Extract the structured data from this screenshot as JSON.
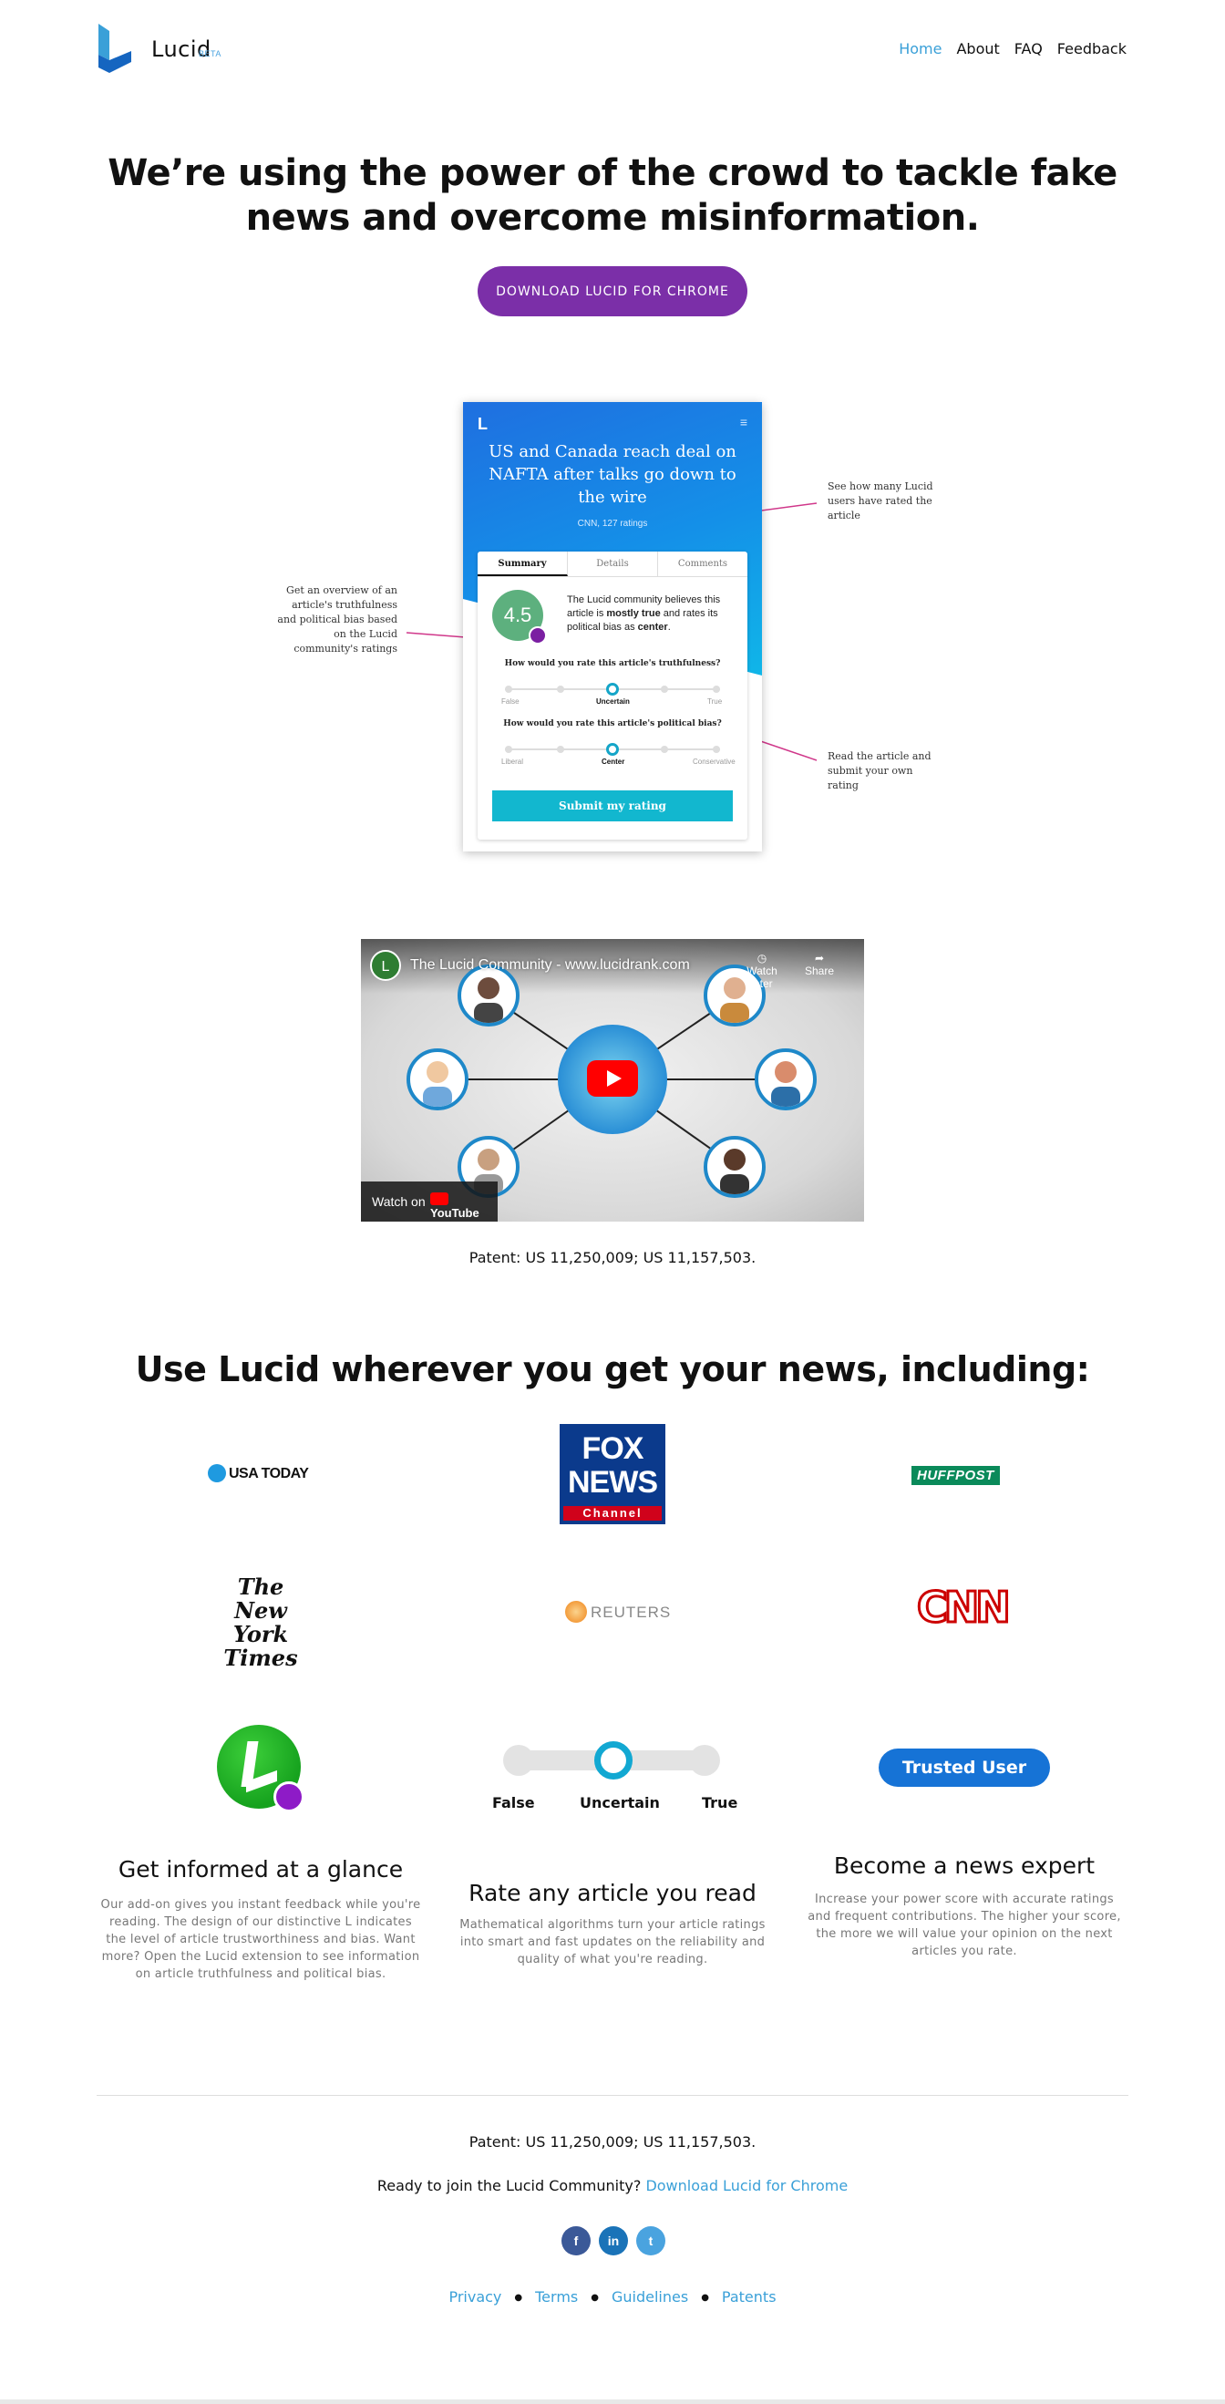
{
  "nav": {
    "logo_text": "Lucid",
    "logo_badge": "BETA",
    "links": [
      "Home",
      "About",
      "FAQ",
      "Feedback"
    ],
    "active": "Home"
  },
  "hero": {
    "title_line1": "We’re using the power of the crowd to tackle fake",
    "title_line2": "news and overcome misinformation.",
    "cta_label": "DOWNLOAD LUCID FOR CHROME"
  },
  "mockup": {
    "logo": "L",
    "menu_icon": "≡",
    "headline": "US and Canada reach deal on NAFTA after talks go down to the wire",
    "ratings": "CNN, 127 ratings",
    "tabs": [
      "Summary",
      "Details",
      "Comments"
    ],
    "score": "4.5",
    "summary_pre": "The Lucid community believes this article is ",
    "summary_bold1": "mostly true",
    "summary_mid": " and rates its political bias as ",
    "summary_bold2": "center",
    "summary_end": ".",
    "q1": "How would you rate this article's truthfulness?",
    "q1_labels": [
      "False",
      "Uncertain",
      "True"
    ],
    "q2": "How would you rate this article's political bias?",
    "q2_labels": [
      "Liberal",
      "Center",
      "Conservative"
    ],
    "submit_label": "Submit my rating"
  },
  "annotations": {
    "left": "Get an overview of an article's truthfulness and political bias based on the Lucid community's ratings",
    "right_top": "See how many Lucid users have rated the article",
    "right_bottom": "Read the article and submit your own rating"
  },
  "video": {
    "channel_initial": "L",
    "title": "The Lucid Community - www.lucidrank.com",
    "watch_later": "Watch later",
    "share": "Share",
    "watch_on": "Watch on",
    "youtube": "YouTube"
  },
  "patent_text": "Patent: US 11,250,009; US 11,157,503.",
  "section_title": "Use Lucid wherever you get your news, including:",
  "brands": {
    "usatoday": "USA TODAY",
    "fox_line1": "FOX",
    "fox_line2": "NEWS",
    "fox_channel": "Channel",
    "huffpost": "HUFFPOST",
    "nyt_line1": "The",
    "nyt_line2": "New York",
    "nyt_line3": "Times",
    "reuters": "REUTERS",
    "cnn": "CNN"
  },
  "features": {
    "slider_labels": [
      "False",
      "Uncertain",
      "True"
    ],
    "trusted_badge": "Trusted User",
    "items": [
      {
        "heading": "Get informed at a glance",
        "text": "Our add-on gives you instant feedback while you're reading. The design of our distinctive L indicates the level of article trustworthiness and bias. Want more? Open the Lucid extension to see information on article truthfulness and political bias."
      },
      {
        "heading": "Rate any article you read",
        "text": "Mathematical algorithms turn your article ratings into smart and fast updates on the reliability and quality of what you're reading."
      },
      {
        "heading": "Become a news expert",
        "text": "Increase your power score with accurate ratings and frequent contributions. The higher your score, the more we will value your opinion on the next articles you rate."
      }
    ]
  },
  "footer": {
    "patent": "Patent: US 11,250,009; US 11,157,503.",
    "join_text": "Ready to join the Lucid Community?",
    "join_link": "Download Lucid for Chrome",
    "social": [
      "f",
      "in",
      "t"
    ],
    "links": [
      "Privacy",
      "Terms",
      "Guidelines",
      "Patents"
    ]
  },
  "colors": {
    "accent": "#3aa0d8",
    "cta": "#7b2fa8",
    "mock_blue": "#1f6fe0",
    "score_green": "#5db07e",
    "submit_teal": "#12b7cf",
    "annotation_line": "#d0378a"
  }
}
